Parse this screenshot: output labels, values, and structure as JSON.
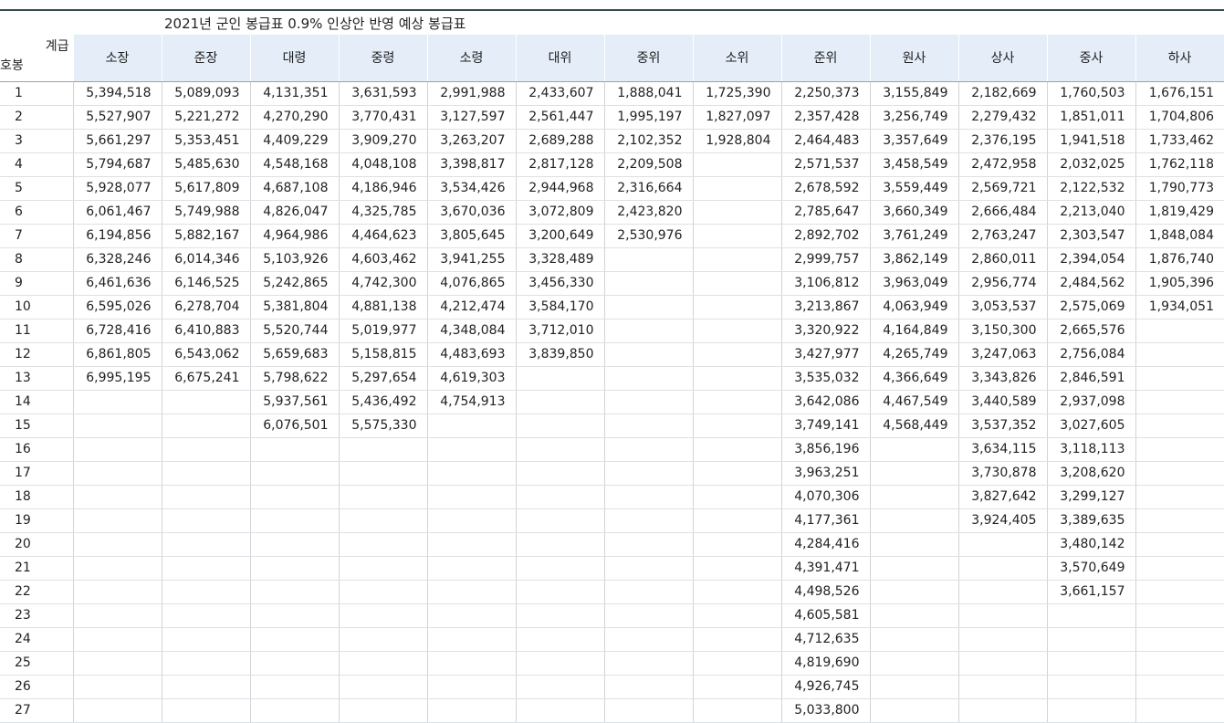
{
  "title": "2021년 군인 봉급표 0.9% 인상안 반영 예상 봉급표",
  "header": {
    "corner_rank_label": "계급",
    "corner_step_label": "호봉",
    "ranks": [
      "소장",
      "준장",
      "대령",
      "중령",
      "소령",
      "대위",
      "중위",
      "소위",
      "준위",
      "원사",
      "상사",
      "중사",
      "하사"
    ]
  },
  "rows": [
    {
      "step": "1",
      "values": [
        "5,394,518",
        "5,089,093",
        "4,131,351",
        "3,631,593",
        "2,991,988",
        "2,433,607",
        "1,888,041",
        "1,725,390",
        "2,250,373",
        "3,155,849",
        "2,182,669",
        "1,760,503",
        "1,676,151"
      ]
    },
    {
      "step": "2",
      "values": [
        "5,527,907",
        "5,221,272",
        "4,270,290",
        "3,770,431",
        "3,127,597",
        "2,561,447",
        "1,995,197",
        "1,827,097",
        "2,357,428",
        "3,256,749",
        "2,279,432",
        "1,851,011",
        "1,704,806"
      ]
    },
    {
      "step": "3",
      "values": [
        "5,661,297",
        "5,353,451",
        "4,409,229",
        "3,909,270",
        "3,263,207",
        "2,689,288",
        "2,102,352",
        "1,928,804",
        "2,464,483",
        "3,357,649",
        "2,376,195",
        "1,941,518",
        "1,733,462"
      ]
    },
    {
      "step": "4",
      "values": [
        "5,794,687",
        "5,485,630",
        "4,548,168",
        "4,048,108",
        "3,398,817",
        "2,817,128",
        "2,209,508",
        "",
        "2,571,537",
        "3,458,549",
        "2,472,958",
        "2,032,025",
        "1,762,118"
      ]
    },
    {
      "step": "5",
      "values": [
        "5,928,077",
        "5,617,809",
        "4,687,108",
        "4,186,946",
        "3,534,426",
        "2,944,968",
        "2,316,664",
        "",
        "2,678,592",
        "3,559,449",
        "2,569,721",
        "2,122,532",
        "1,790,773"
      ]
    },
    {
      "step": "6",
      "values": [
        "6,061,467",
        "5,749,988",
        "4,826,047",
        "4,325,785",
        "3,670,036",
        "3,072,809",
        "2,423,820",
        "",
        "2,785,647",
        "3,660,349",
        "2,666,484",
        "2,213,040",
        "1,819,429"
      ]
    },
    {
      "step": "7",
      "values": [
        "6,194,856",
        "5,882,167",
        "4,964,986",
        "4,464,623",
        "3,805,645",
        "3,200,649",
        "2,530,976",
        "",
        "2,892,702",
        "3,761,249",
        "2,763,247",
        "2,303,547",
        "1,848,084"
      ]
    },
    {
      "step": "8",
      "values": [
        "6,328,246",
        "6,014,346",
        "5,103,926",
        "4,603,462",
        "3,941,255",
        "3,328,489",
        "",
        "",
        "2,999,757",
        "3,862,149",
        "2,860,011",
        "2,394,054",
        "1,876,740"
      ]
    },
    {
      "step": "9",
      "values": [
        "6,461,636",
        "6,146,525",
        "5,242,865",
        "4,742,300",
        "4,076,865",
        "3,456,330",
        "",
        "",
        "3,106,812",
        "3,963,049",
        "2,956,774",
        "2,484,562",
        "1,905,396"
      ]
    },
    {
      "step": "10",
      "values": [
        "6,595,026",
        "6,278,704",
        "5,381,804",
        "4,881,138",
        "4,212,474",
        "3,584,170",
        "",
        "",
        "3,213,867",
        "4,063,949",
        "3,053,537",
        "2,575,069",
        "1,934,051"
      ]
    },
    {
      "step": "11",
      "values": [
        "6,728,416",
        "6,410,883",
        "5,520,744",
        "5,019,977",
        "4,348,084",
        "3,712,010",
        "",
        "",
        "3,320,922",
        "4,164,849",
        "3,150,300",
        "2,665,576",
        ""
      ]
    },
    {
      "step": "12",
      "values": [
        "6,861,805",
        "6,543,062",
        "5,659,683",
        "5,158,815",
        "4,483,693",
        "3,839,850",
        "",
        "",
        "3,427,977",
        "4,265,749",
        "3,247,063",
        "2,756,084",
        ""
      ]
    },
    {
      "step": "13",
      "values": [
        "6,995,195",
        "6,675,241",
        "5,798,622",
        "5,297,654",
        "4,619,303",
        "",
        "",
        "",
        "3,535,032",
        "4,366,649",
        "3,343,826",
        "2,846,591",
        ""
      ]
    },
    {
      "step": "14",
      "values": [
        "",
        "",
        "5,937,561",
        "5,436,492",
        "4,754,913",
        "",
        "",
        "",
        "3,642,086",
        "4,467,549",
        "3,440,589",
        "2,937,098",
        ""
      ]
    },
    {
      "step": "15",
      "values": [
        "",
        "",
        "6,076,501",
        "5,575,330",
        "",
        "",
        "",
        "",
        "3,749,141",
        "4,568,449",
        "3,537,352",
        "3,027,605",
        ""
      ]
    },
    {
      "step": "16",
      "values": [
        "",
        "",
        "",
        "",
        "",
        "",
        "",
        "",
        "3,856,196",
        "",
        "3,634,115",
        "3,118,113",
        ""
      ]
    },
    {
      "step": "17",
      "values": [
        "",
        "",
        "",
        "",
        "",
        "",
        "",
        "",
        "3,963,251",
        "",
        "3,730,878",
        "3,208,620",
        ""
      ]
    },
    {
      "step": "18",
      "values": [
        "",
        "",
        "",
        "",
        "",
        "",
        "",
        "",
        "4,070,306",
        "",
        "3,827,642",
        "3,299,127",
        ""
      ]
    },
    {
      "step": "19",
      "values": [
        "",
        "",
        "",
        "",
        "",
        "",
        "",
        "",
        "4,177,361",
        "",
        "3,924,405",
        "3,389,635",
        ""
      ]
    },
    {
      "step": "20",
      "values": [
        "",
        "",
        "",
        "",
        "",
        "",
        "",
        "",
        "4,284,416",
        "",
        "",
        "3,480,142",
        ""
      ]
    },
    {
      "step": "21",
      "values": [
        "",
        "",
        "",
        "",
        "",
        "",
        "",
        "",
        "4,391,471",
        "",
        "",
        "3,570,649",
        ""
      ]
    },
    {
      "step": "22",
      "values": [
        "",
        "",
        "",
        "",
        "",
        "",
        "",
        "",
        "4,498,526",
        "",
        "",
        "3,661,157",
        ""
      ]
    },
    {
      "step": "23",
      "values": [
        "",
        "",
        "",
        "",
        "",
        "",
        "",
        "",
        "4,605,581",
        "",
        "",
        "",
        ""
      ]
    },
    {
      "step": "24",
      "values": [
        "",
        "",
        "",
        "",
        "",
        "",
        "",
        "",
        "4,712,635",
        "",
        "",
        "",
        ""
      ]
    },
    {
      "step": "25",
      "values": [
        "",
        "",
        "",
        "",
        "",
        "",
        "",
        "",
        "4,819,690",
        "",
        "",
        "",
        ""
      ]
    },
    {
      "step": "26",
      "values": [
        "",
        "",
        "",
        "",
        "",
        "",
        "",
        "",
        "4,926,745",
        "",
        "",
        "",
        ""
      ]
    },
    {
      "step": "27",
      "values": [
        "",
        "",
        "",
        "",
        "",
        "",
        "",
        "",
        "5,033,800",
        "",
        "",
        "",
        ""
      ]
    }
  ]
}
